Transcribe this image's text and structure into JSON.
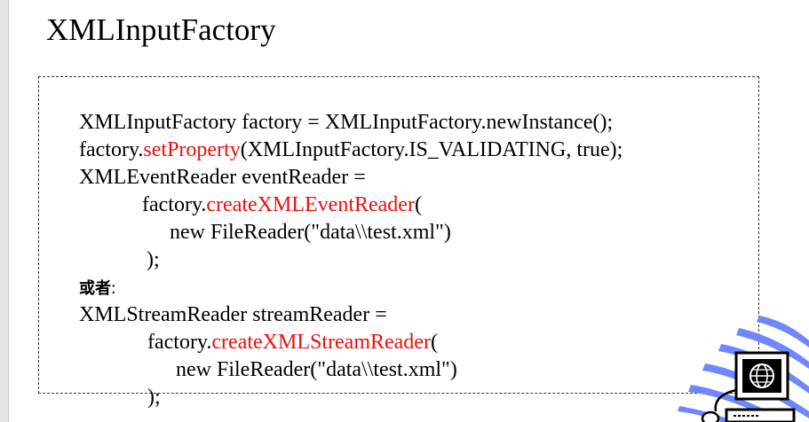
{
  "title": "XMLInputFactory",
  "code": {
    "l1": "XMLInputFactory factory = XMLInputFactory.newInstance();",
    "l2_obj": "factory.",
    "l2_method": "setProperty",
    "l2_args": "(XMLInputFactory.IS_VALIDATING, true);",
    "l3": "XMLEventReader eventReader =",
    "l4_obj": "factory.",
    "l4_method": "createXMLEventReader",
    "l4_paren": "(",
    "l5": "new FileReader(\"data\\\\test.xml\")",
    "l6": ");",
    "or_cjk": "或者",
    "or_colon": ":",
    "l8": "XMLStreamReader streamReader =",
    "l9_obj": "factory.",
    "l9_method": "createXMLStreamReader",
    "l9_paren": "(",
    "l10": "new FileReader(\"data\\\\test.xml\")",
    "l11": ");"
  },
  "colors": {
    "method_highlight": "#e8110f",
    "decoration_blue": "#6f86ff"
  },
  "icons": {
    "decoration": "computer-globe-icon"
  }
}
